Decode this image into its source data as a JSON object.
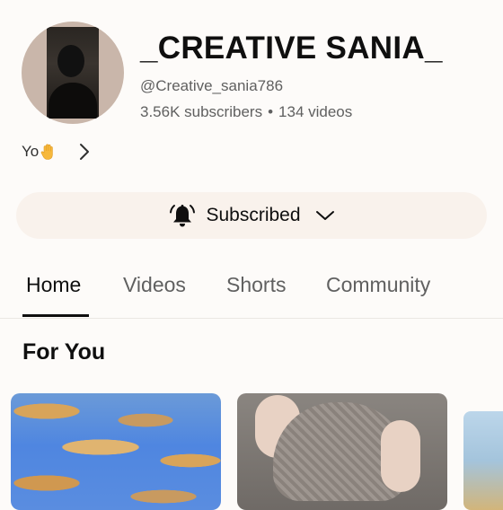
{
  "channel": {
    "name": "_CREATIVE SANIA_",
    "handle": "@Creative_sania786",
    "subscribers": "3.56K subscribers",
    "separator": "•",
    "videos": "134 videos",
    "description": "Yo"
  },
  "icons": {
    "description_emoji": "raised-hand-icon",
    "more": "chevron-right-icon",
    "notify": "bell-icon",
    "menu": "chevron-down-icon"
  },
  "subscribe": {
    "label": "Subscribed"
  },
  "tabs": [
    {
      "label": "Home",
      "active": true
    },
    {
      "label": "Videos",
      "active": false
    },
    {
      "label": "Shorts",
      "active": false
    },
    {
      "label": "Community",
      "active": false
    }
  ],
  "section": {
    "title": "For You"
  },
  "colors": {
    "background": "#fdfbf9",
    "button_background": "#f9f2ec",
    "text_primary": "#0f0f0f",
    "text_secondary": "#606060"
  }
}
